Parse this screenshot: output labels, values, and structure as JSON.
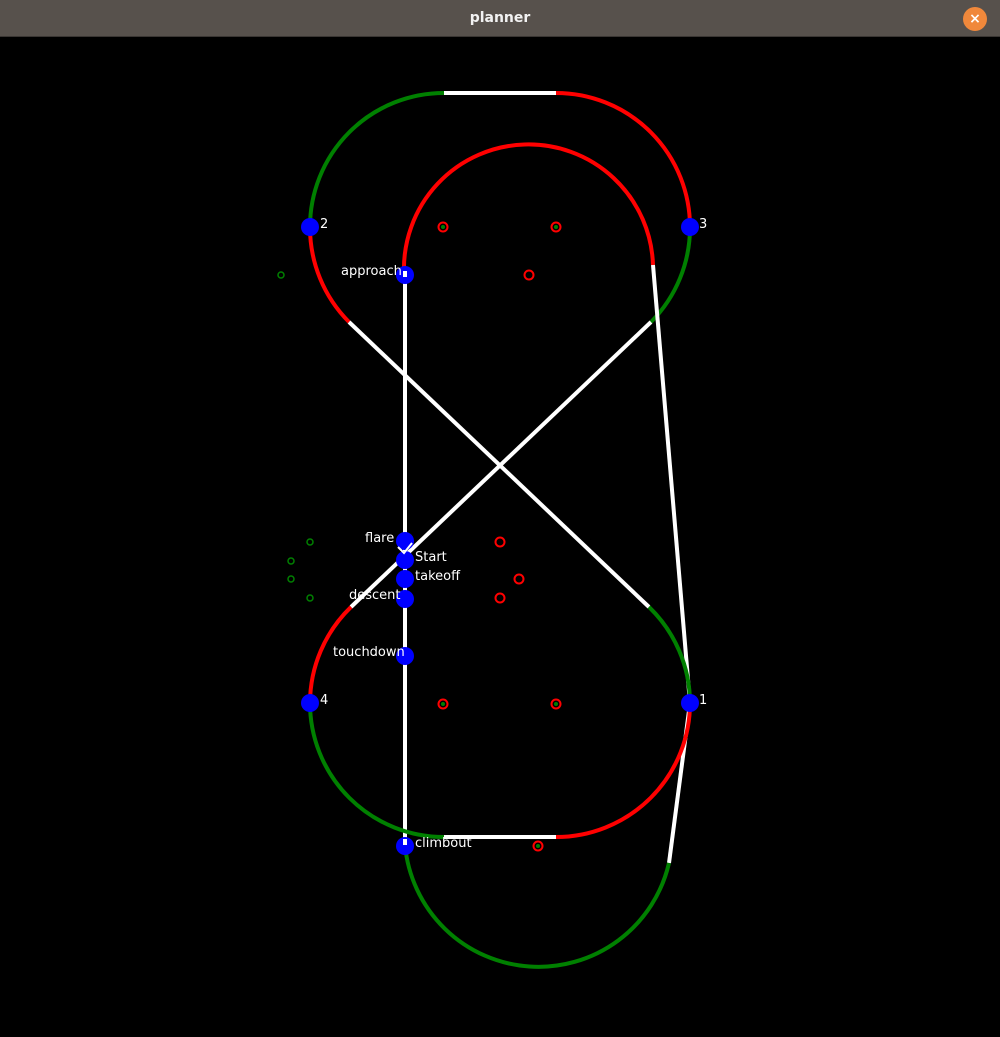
{
  "window": {
    "title": "planner",
    "close_icon": "×"
  },
  "colors": {
    "straight": "#ffffff",
    "turn_left": "#ff0000",
    "turn_right": "#008000",
    "waypoint": "#0000ff",
    "label": "#ffffff",
    "background": "#000000"
  },
  "waypoints": {
    "wp1": "1",
    "wp2": "2",
    "wp3": "3",
    "wp4": "4",
    "approach": "approach",
    "flare": "flare",
    "start": "Start",
    "takeoff": "takeoff",
    "descent": "descent",
    "touchdown": "touchdown",
    "climbout": "climbout"
  }
}
